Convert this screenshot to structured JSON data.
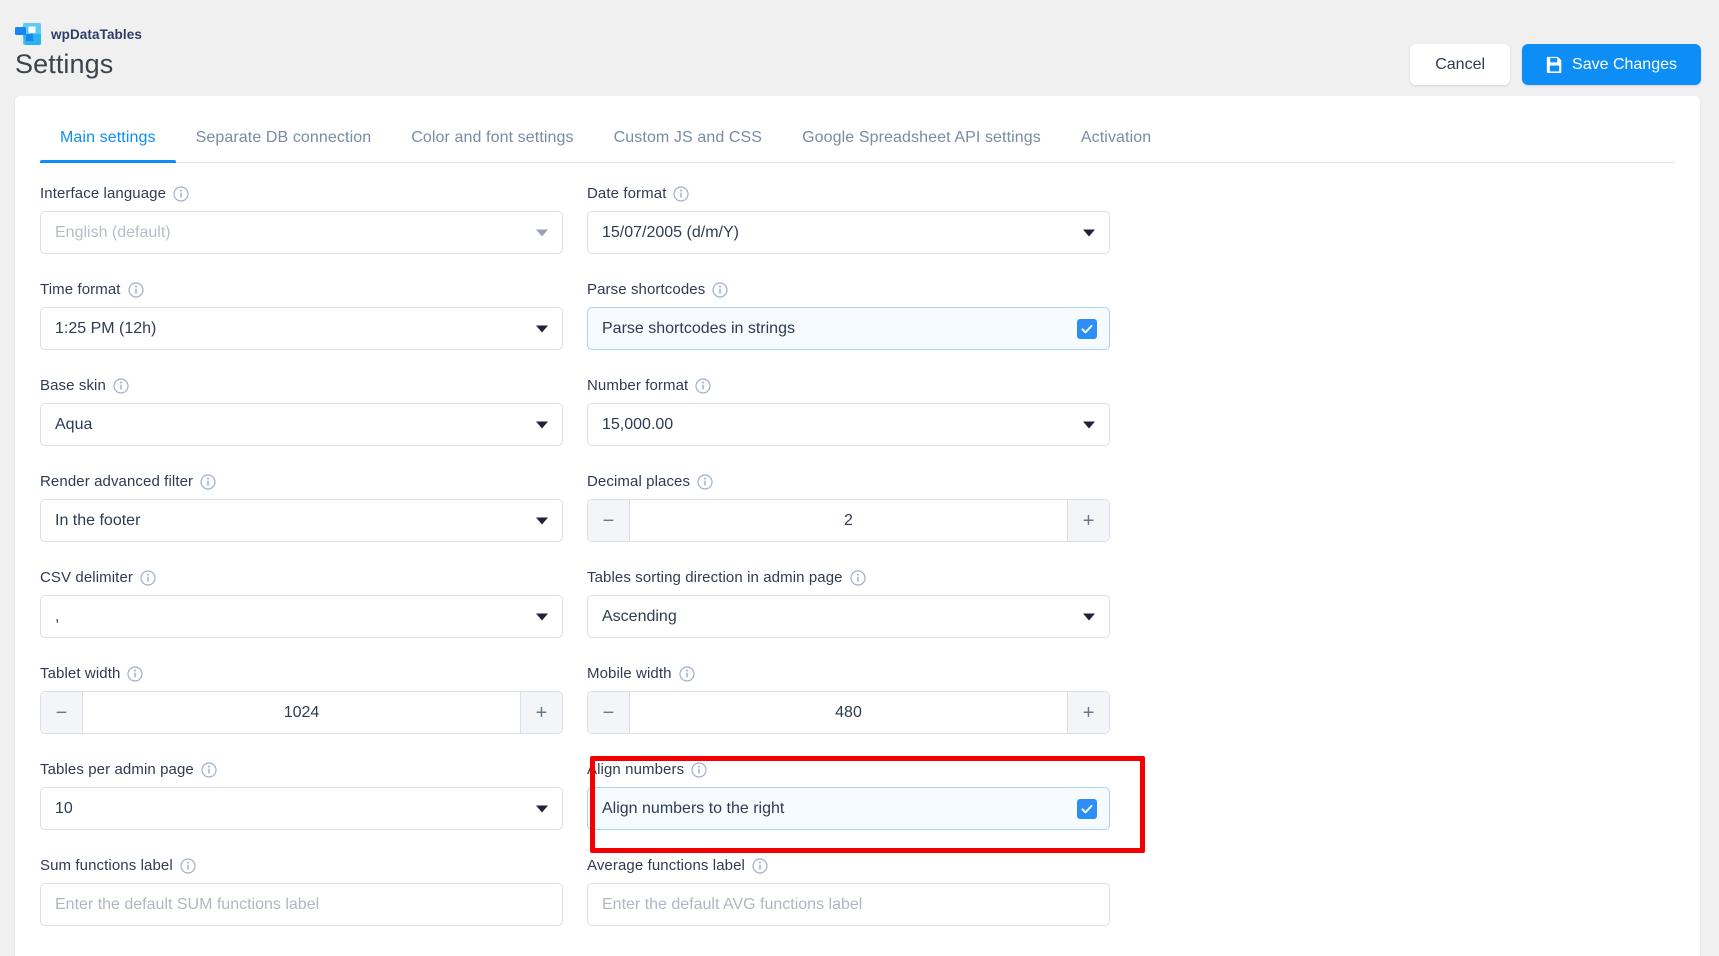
{
  "brand": {
    "name": "wpDataTables",
    "logo_icon": "wpdatatables-logo-icon"
  },
  "header": {
    "title": "Settings",
    "cancel_label": "Cancel",
    "save_label": "Save Changes",
    "save_icon": "floppy-disk-save-icon",
    "accent_color": "#0d8ef7",
    "cancel_bg": "#ffffff",
    "page_bg": "#f0f0f1"
  },
  "tabs": [
    {
      "label": "Main settings",
      "active": true
    },
    {
      "label": "Separate DB connection",
      "active": false
    },
    {
      "label": "Color and font settings",
      "active": false
    },
    {
      "label": "Custom JS and CSS",
      "active": false
    },
    {
      "label": "Google Spreadsheet API settings",
      "active": false
    },
    {
      "label": "Activation",
      "active": false
    }
  ],
  "fields": {
    "interface_language": {
      "label": "Interface language",
      "info_icon": "info-circle-icon",
      "value": "English (default)",
      "disabled": true,
      "caret_icon": "chevron-down-icon"
    },
    "date_format": {
      "label": "Date format",
      "info_icon": "info-circle-icon",
      "value": "15/07/2005 (d/m/Y)",
      "caret_icon": "chevron-down-icon"
    },
    "time_format": {
      "label": "Time format",
      "info_icon": "info-circle-icon",
      "value": "1:25 PM (12h)",
      "caret_icon": "chevron-down-icon"
    },
    "parse_shortcodes": {
      "label": "Parse shortcodes",
      "info_icon": "info-circle-icon",
      "checkbox_label": "Parse shortcodes in strings",
      "checked": true,
      "check_icon": "checkmark-icon"
    },
    "base_skin": {
      "label": "Base skin",
      "info_icon": "info-circle-icon",
      "value": "Aqua",
      "caret_icon": "chevron-down-icon"
    },
    "number_format": {
      "label": "Number format",
      "info_icon": "info-circle-icon",
      "value": "15,000.00",
      "caret_icon": "chevron-down-icon"
    },
    "render_advanced_filter": {
      "label": "Render advanced filter",
      "info_icon": "info-circle-icon",
      "value": "In the footer",
      "caret_icon": "chevron-down-icon"
    },
    "decimal_places": {
      "label": "Decimal places",
      "info_icon": "info-circle-icon",
      "value": "2",
      "minus_label": "−",
      "plus_label": "+"
    },
    "csv_delimiter": {
      "label": "CSV delimiter",
      "info_icon": "info-circle-icon",
      "value": ",",
      "caret_icon": "chevron-down-icon"
    },
    "tables_sorting_direction": {
      "label": "Tables sorting direction in admin page",
      "info_icon": "info-circle-icon",
      "value": "Ascending",
      "caret_icon": "chevron-down-icon"
    },
    "tablet_width": {
      "label": "Tablet width",
      "info_icon": "info-circle-icon",
      "value": "1024",
      "minus_label": "−",
      "plus_label": "+"
    },
    "mobile_width": {
      "label": "Mobile width",
      "info_icon": "info-circle-icon",
      "value": "480",
      "minus_label": "−",
      "plus_label": "+"
    },
    "tables_per_admin_page": {
      "label": "Tables per admin page",
      "info_icon": "info-circle-icon",
      "value": "10",
      "caret_icon": "chevron-down-icon"
    },
    "align_numbers": {
      "label": "Align numbers",
      "info_icon": "info-circle-icon",
      "checkbox_label": "Align numbers to the right",
      "checked": true,
      "check_icon": "checkmark-icon",
      "highlighted": true,
      "highlight_color": "#f40000"
    },
    "sum_functions_label": {
      "label": "Sum functions label",
      "info_icon": "info-circle-icon",
      "value": "",
      "placeholder": "Enter the default SUM functions label"
    },
    "average_functions_label": {
      "label": "Average functions label",
      "info_icon": "info-circle-icon",
      "value": "",
      "placeholder": "Enter the default AVG functions label"
    }
  }
}
